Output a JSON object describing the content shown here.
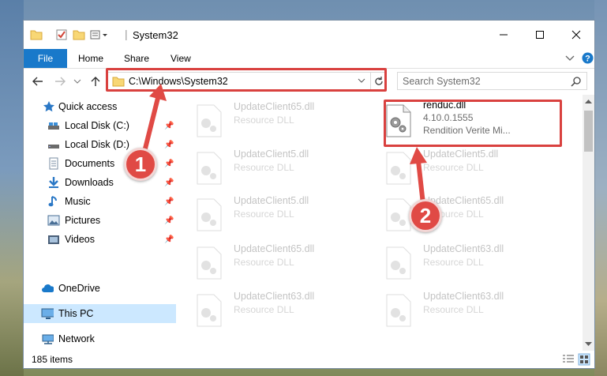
{
  "window": {
    "title": "System32"
  },
  "ribbon": {
    "tabs": [
      "File",
      "Home",
      "Share",
      "View"
    ]
  },
  "nav": {
    "address": "C:\\Windows\\System32",
    "search_placeholder": "Search System32"
  },
  "sidebar": {
    "items": [
      {
        "label": "Quick access",
        "icon": "star-icon"
      },
      {
        "label": "Local Disk (C:)",
        "icon": "drive-icon",
        "pinned": true
      },
      {
        "label": "Local Disk (D:)",
        "icon": "drive-icon",
        "pinned": true
      },
      {
        "label": "Documents",
        "icon": "documents-icon",
        "pinned": true
      },
      {
        "label": "Downloads",
        "icon": "download-icon",
        "pinned": true
      },
      {
        "label": "Music",
        "icon": "music-icon",
        "pinned": true
      },
      {
        "label": "Pictures",
        "icon": "pictures-icon",
        "pinned": true
      },
      {
        "label": "Videos",
        "icon": "videos-icon",
        "pinned": true
      },
      {
        "label": "OneDrive",
        "icon": "cloud-icon"
      },
      {
        "label": "This PC",
        "icon": "computer-icon",
        "selected": true
      },
      {
        "label": "Network",
        "icon": "network-icon"
      }
    ]
  },
  "files": {
    "left_column": [
      {
        "name": "UpdateClient65.dll",
        "desc": "Resource DLL"
      },
      {
        "name": "UpdateClient5.dll",
        "desc": "Resource DLL"
      },
      {
        "name": "UpdateClient5.dll",
        "desc": "Resource DLL"
      },
      {
        "name": "UpdateClient65.dll",
        "desc": "Resource DLL"
      },
      {
        "name": "UpdateClient63.dll",
        "desc": "Resource DLL"
      }
    ],
    "right_column": [
      {
        "name": "renduc.dll",
        "version": "4.10.0.1555",
        "desc": "Rendition Verite Mi...",
        "selected": true
      },
      {
        "name": "UpdateClient5.dll",
        "desc": "Resource DLL"
      },
      {
        "name": "UpdateClient65.dll",
        "desc": "Resource DLL"
      },
      {
        "name": "UpdateClient63.dll",
        "desc": "Resource DLL"
      },
      {
        "name": "UpdateClient63.dll",
        "desc": "Resource DLL"
      }
    ]
  },
  "status": {
    "item_count": "185 items"
  },
  "annotations": {
    "step1": "1",
    "step2": "2"
  },
  "colors": {
    "accent": "#1979ca",
    "highlight": "#d9413f",
    "selection": "#cce8ff"
  }
}
